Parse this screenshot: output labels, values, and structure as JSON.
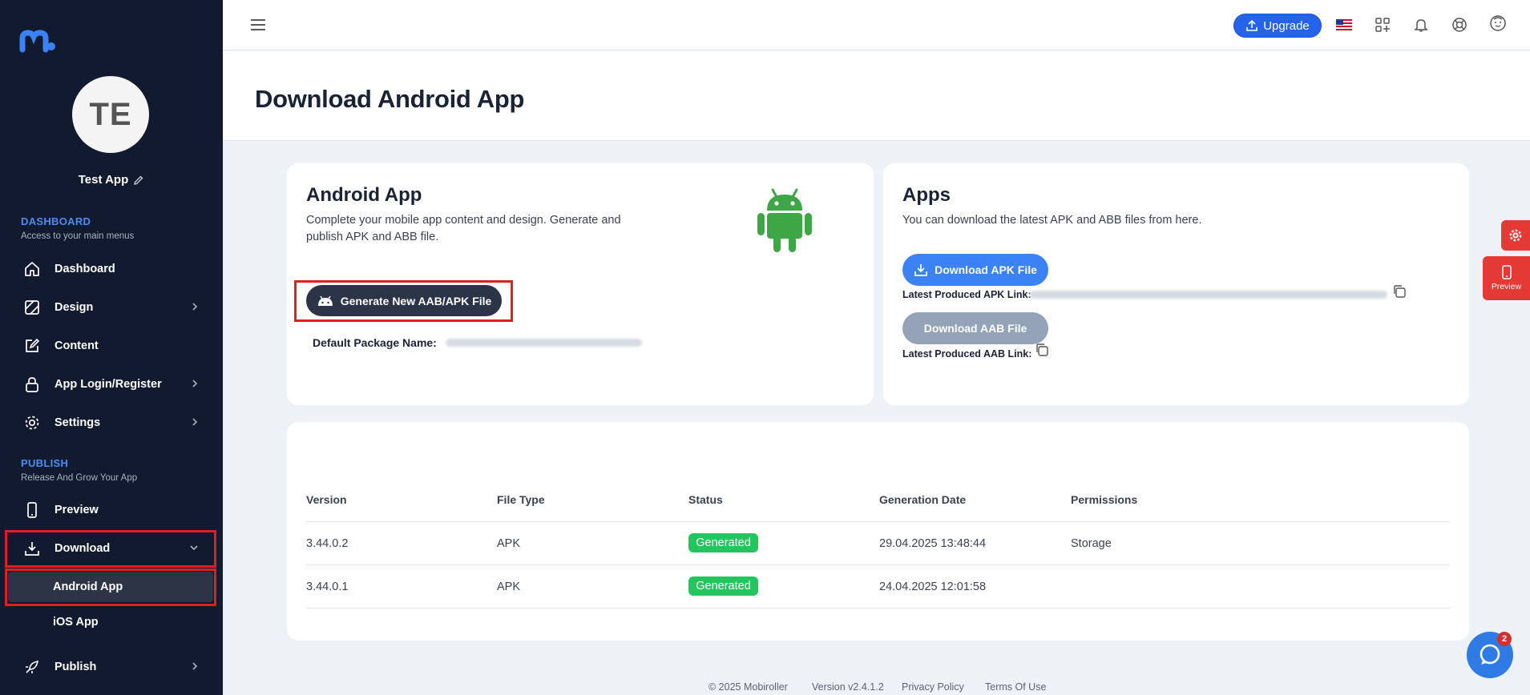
{
  "sidebar": {
    "avatar_initials": "TE",
    "app_name": "Test App",
    "sections": {
      "dashboard_title": "DASHBOARD",
      "dashboard_sub": "Access to your main menus",
      "publish_title": "PUBLISH",
      "publish_sub": "Release And Grow Your App"
    },
    "items": {
      "dashboard": "Dashboard",
      "design": "Design",
      "content": "Content",
      "login": "App Login/Register",
      "settings": "Settings",
      "preview": "Preview",
      "download": "Download",
      "android": "Android App",
      "ios": "iOS App",
      "publish": "Publish"
    }
  },
  "topbar": {
    "upgrade_label": "Upgrade"
  },
  "page": {
    "title": "Download Android App"
  },
  "android_card": {
    "title": "Android App",
    "description": "Complete your mobile app content and design. Generate and publish APK and ABB file.",
    "generate_label": "Generate New AAB/APK File",
    "package_label": "Default Package Name:"
  },
  "apps_card": {
    "title": "Apps",
    "description": "You can download the latest APK and ABB files from here.",
    "apk_button": "Download APK File",
    "apk_link_label": "Latest Produced APK Link:",
    "aab_button": "Download AAB File",
    "aab_link_label": "Latest Produced AAB Link:"
  },
  "table": {
    "headers": [
      "Version",
      "File Type",
      "Status",
      "Generation Date",
      "Permissions"
    ],
    "rows": [
      {
        "version": "3.44.0.2",
        "type": "APK",
        "status": "Generated",
        "date": "29.04.2025 13:48:44",
        "permissions": "Storage"
      },
      {
        "version": "3.44.0.1",
        "type": "APK",
        "status": "Generated",
        "date": "24.04.2025 12:01:58",
        "permissions": ""
      }
    ]
  },
  "floaters": {
    "preview_label": "Preview",
    "chat_count": "2"
  },
  "footer": {
    "copyright": "© 2025 Mobiroller",
    "version": "Version v2.4.1.2",
    "privacy": "Privacy Policy",
    "terms": "Terms Of Use"
  },
  "colors": {
    "sidebar_bg": "#111a2e",
    "accent_blue": "#2563eb",
    "highlight_red": "#e02020",
    "success_green": "#22c55e",
    "android_green": "#3ddc84"
  }
}
